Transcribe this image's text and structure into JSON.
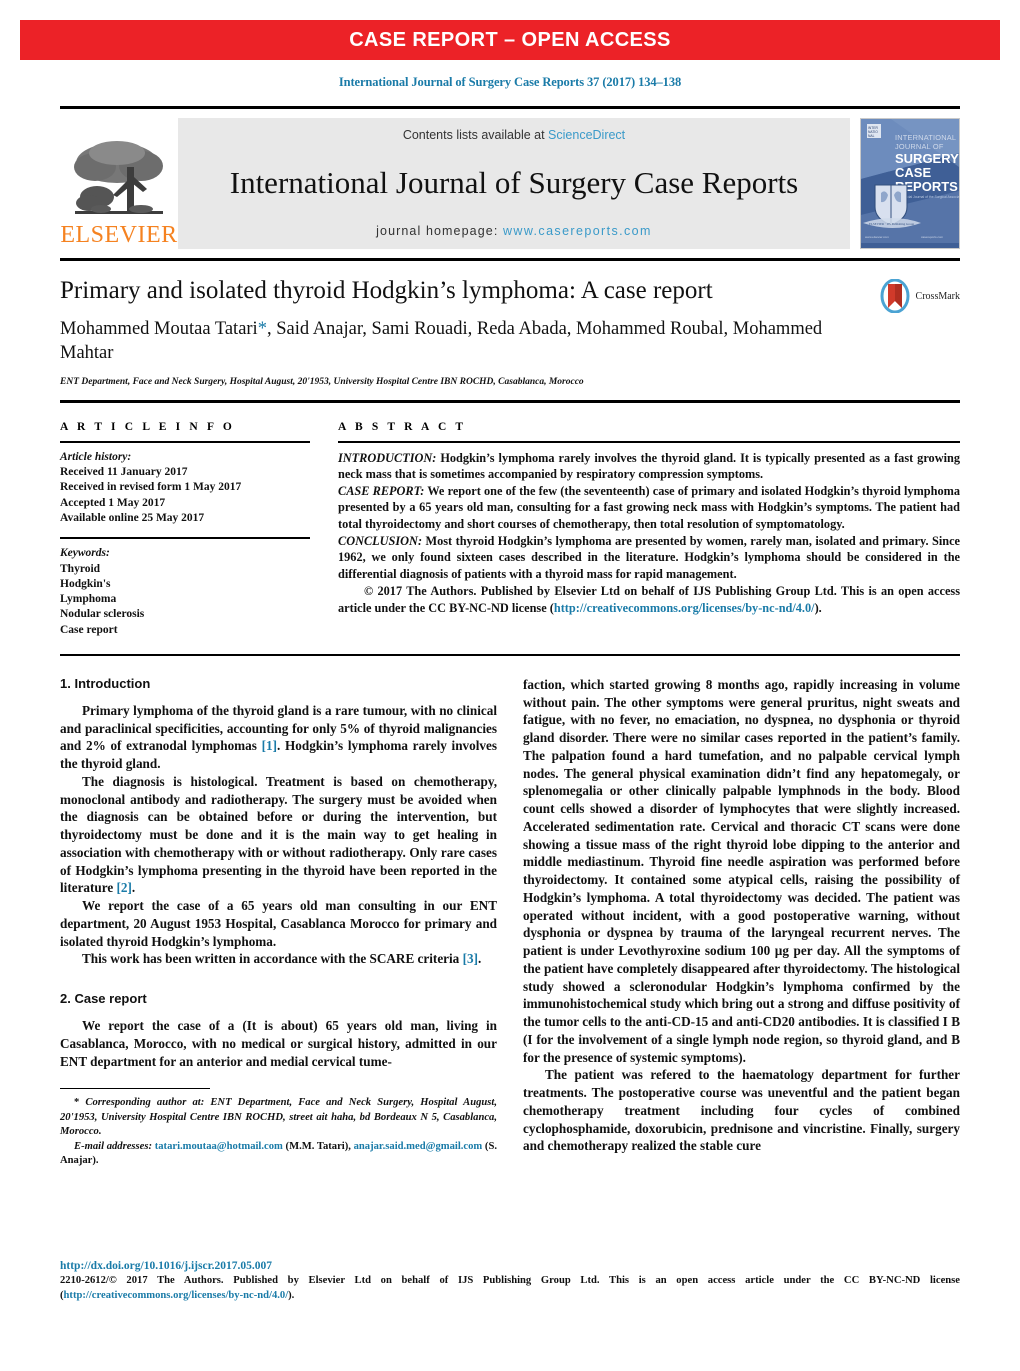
{
  "banner": {
    "text": "CASE REPORT – OPEN ACCESS",
    "color": "#ec2227"
  },
  "running_head": "International Journal of Surgery Case Reports 37 (2017) 134–138",
  "masthead": {
    "publisher_logo_word": "ELSEVIER",
    "publisher_logo_color": "#f58220",
    "contents_prefix": "Contents lists available at ",
    "contents_link": "ScienceDirect",
    "journal_title": "International Journal of Surgery Case Reports",
    "homepage_prefix": "journal homepage: ",
    "homepage_url": "www.casereports.com",
    "cover": {
      "line1": "INTERNATIONAL",
      "line2": "JOURNAL OF",
      "line3": "SURGERY",
      "line4": "CASE",
      "line5": "REPORTS"
    }
  },
  "article": {
    "title": "Primary and isolated thyroid Hodgkin’s lymphoma: A case report",
    "authors_line1": "Mohammed Moutaa Tatari",
    "authors_star": "*",
    "authors_line1_rest": ", Said Anajar, Sami Rouadi, Reda Abada, Mohammed Roubal,",
    "authors_line2": "Mohammed Mahtar",
    "affiliation": "ENT Department, Face and Neck Surgery, Hospital August, 20'1953, University Hospital Centre IBN ROCHD, Casablanca, Morocco",
    "crossmark_label": "CrossMark"
  },
  "article_info": {
    "heading": "A R T I C L E   I N F O",
    "history_label": "Article history:",
    "history": [
      "Received 11 January 2017",
      "Received in revised form 1 May 2017",
      "Accepted 1 May 2017",
      "Available online 25 May 2017"
    ],
    "keywords_label": "Keywords:",
    "keywords": [
      "Thyroid",
      "Hodgkin's",
      "Lymphoma",
      "Nodular sclerosis",
      "Case report"
    ]
  },
  "abstract": {
    "heading": "A B S T R A C T",
    "intro_label": "INTRODUCTION:",
    "intro_text": " Hodgkin’s lymphoma rarely involves the thyroid gland. It is typically presented as a fast growing neck mass that is sometimes accompanied by respiratory compression symptoms.",
    "case_label": "CASE REPORT:",
    "case_text": " We report one of the few (the seventeenth) case of primary and isolated Hodgkin’s thyroid lymphoma presented by a 65 years old man, consulting for a fast growing neck mass with Hodgkin’s symptoms. The patient had total thyroidectomy and short courses of chemotherapy, then total resolution of symptomatology.",
    "conclusion_label": "CONCLUSION:",
    "conclusion_text": " Most thyroid Hodgkin’s lymphoma are presented by women, rarely man, isolated and primary. Since 1962, we only found sixteen cases described in the literature. Hodgkin’s lymphoma should be considered in the differential diagnosis of patients with a thyroid mass for rapid management.",
    "copyright_part1": "© 2017 The Authors. Published by Elsevier Ltd on behalf of IJS Publishing Group Ltd. This is an open access article under the CC BY-NC-ND license (",
    "copyright_link": "http://creativecommons.org/licenses/by-nc-nd/4.0/",
    "copyright_part2": ")."
  },
  "sections": {
    "intro_heading": "1.  Introduction",
    "case_heading": "2.  Case report"
  },
  "left_column": {
    "p1_a": "Primary lymphoma of the thyroid gland is a rare tumour, with no clinical and paraclinical specificities, accounting for only 5% of thyroid malignancies and 2% of extranodal lymphomas ",
    "p1_ref": "[1]",
    "p1_b": ". Hodgkin’s lymphoma rarely involves the thyroid gland.",
    "p2_a": "The diagnosis is histological. Treatment is based on chemotherapy, monoclonal antibody and radiotherapy. The surgery must be avoided when the diagnosis can be obtained before or during the intervention, but thyroidectomy must be done and it is the main way to get healing in association with chemotherapy with or without radiotherapy. Only rare cases of Hodgkin’s lymphoma presenting in the thyroid have been reported in the literature ",
    "p2_ref": "[2]",
    "p2_b": ".",
    "p3": "We report the case of a 65 years old man consulting in our ENT department, 20 August 1953 Hospital, Casablanca Morocco for primary and isolated thyroid Hodgkin’s lymphoma.",
    "p4_a": "This work has been written in accordance with the SCARE criteria ",
    "p4_ref": "[3]",
    "p4_b": ".",
    "p5": "We report the case of a (It is about) 65 years old man, living in Casablanca, Morocco, with no medical or surgical history, admitted in our ENT department for an anterior and medial cervical tume-"
  },
  "right_column": {
    "p1": "faction, which started growing 8 months ago, rapidly increasing in volume without pain. The other symptoms were general pruritus, night sweats and fatigue, with no fever, no emaciation, no dyspnea, no dysphonia or thyroid gland disorder. There were no similar cases reported in the patient’s family. The palpation found a hard tumefation, and no palpable cervical lymph nodes. The general physical examination didn’t find any hepatomegaly, or splenomegalia or other clinically palpable lymphnods in the body. Blood count cells showed a disorder of lymphocytes that were slightly increased. Accelerated sedimentation rate. Cervical and thoracic CT scans were done showing a tissue mass of the right thyroid lobe dipping to the anterior and middle mediastinum. Thyroid fine needle aspiration was performed before thyroidectomy. It contained some atypical cells, raising the possibility of Hodgkin’s lymphoma. A total thyroidectomy was decided. The patient was operated without incident, with a good postoperative warning, without dysphonia or dyspnea by trauma of the laryngeal recurrent nerves. The patient is under Levothyroxine sodium 100 µg per day. All the symptoms of the patient have completely disappeared after thyroidectomy. The histological study showed a scleronodular Hodgkin’s lymphoma confirmed by the immunohistochemical study which bring out a strong and diffuse positivity of the tumor cells to the anti-CD-15 and anti-CD20 antibodies. It is classified I B (I for the involvement of a single lymph node region, so thyroid gland, and B for the presence of systemic symptoms).",
    "p2": "The patient was refered to the haematology department for further treatments. The postoperative course was uneventful and the patient began chemotherapy treatment including four cycles of combined cyclophosphamide, doxorubicin, prednisone and vincristine. Finally, surgery and chemotherapy realized the stable cure"
  },
  "footnotes": {
    "star": "*",
    "corresponding_text": " Corresponding author at: ENT Department, Face and Neck Surgery, Hospital August, 20'1953, University Hospital Centre IBN ROCHD, street ait haha, bd Bordeaux N 5, Casablanca, Morocco.",
    "email_label": "E-mail addresses:",
    "email1": "tatari.moutaa@hotmail.com",
    "email1_owner": " (M.M. Tatari),",
    "email2": "anajar.said.med@gmail.com",
    "email2_owner": " (S. Anajar)."
  },
  "bottom": {
    "doi": "http://dx.doi.org/10.1016/j.ijscr.2017.05.007",
    "issn_copy_part1": "2210-2612/© 2017 The Authors. Published by Elsevier Ltd on behalf of IJS Publishing Group Ltd. This is an open access article under the CC BY-NC-ND license (",
    "issn_copy_link": "http://creativecommons.org/licenses/by-nc-nd/4.0/",
    "issn_copy_part2": ")."
  },
  "colors": {
    "banner_red": "#ec2227",
    "link_blue": "#1a7ba8",
    "sciencedirect_blue": "#3a9ac9",
    "elsevier_orange": "#f58220"
  }
}
